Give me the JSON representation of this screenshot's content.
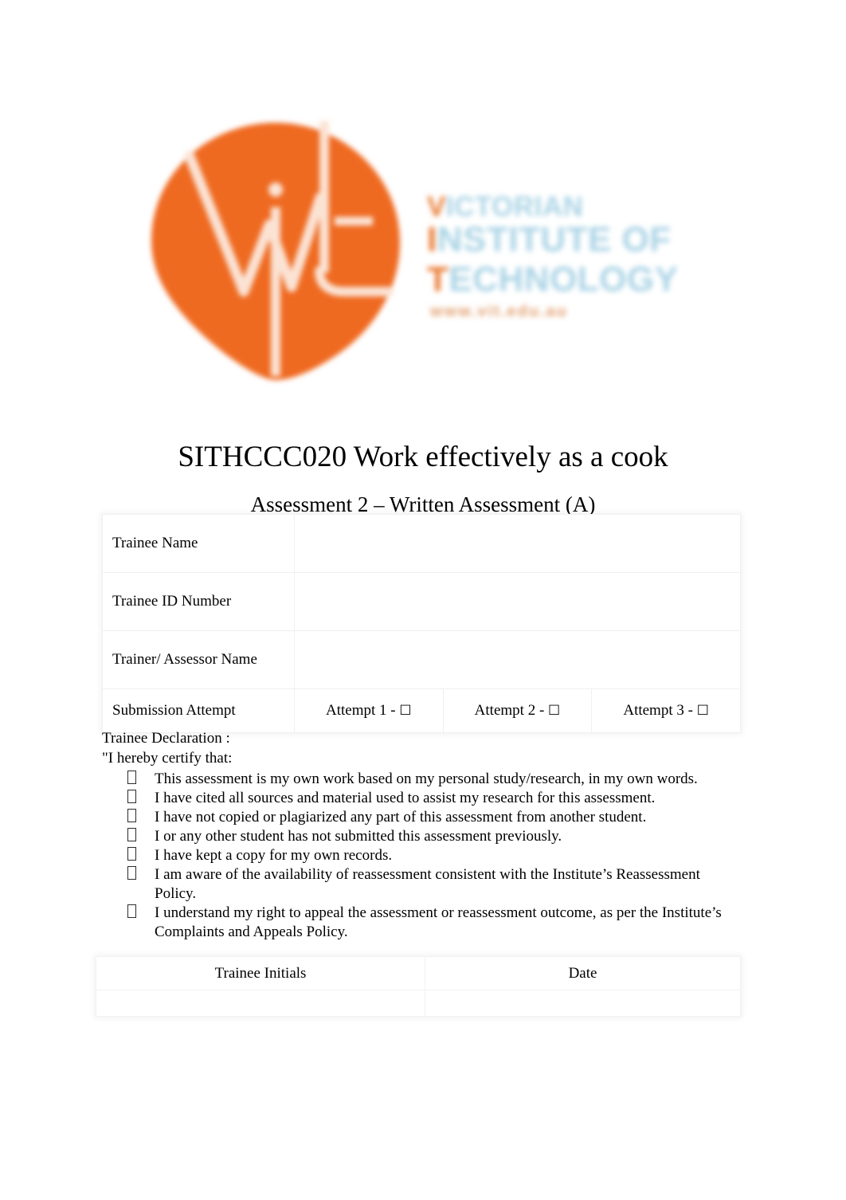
{
  "logo": {
    "mark_alt": "vit-logo-mark",
    "mark_letters": "vit",
    "orange_hex": "#EF6A21",
    "blue_hex": "#A9D3E5",
    "wordmark_lines": [
      {
        "lead": "V",
        "rest": "ICTORIAN"
      },
      {
        "lead": "I",
        "rest": "NSTITUTE OF"
      },
      {
        "lead": "T",
        "rest": "ECHNOLOGY"
      }
    ],
    "url": "www.vit.edu.au"
  },
  "header": {
    "title": "SITHCCC020 Work effectively as a cook",
    "subtitle": "Assessment 2 – Written Assessment (A)"
  },
  "details_table": {
    "rows": [
      {
        "label": "Trainee Name",
        "value": ""
      },
      {
        "label": "Trainee ID Number",
        "value": ""
      },
      {
        "label": "Trainer/ Assessor Name",
        "value": ""
      }
    ],
    "attempt_row": {
      "label": "Submission Attempt",
      "attempts": [
        {
          "label": "Attempt 1 -",
          "checkbox": "☐",
          "checked": false
        },
        {
          "label": "Attempt 2 -",
          "checkbox": "☐",
          "checked": false
        },
        {
          "label": "Attempt 3 -",
          "checkbox": "☐",
          "checked": false
        }
      ]
    }
  },
  "declaration": {
    "heading": "Trainee Declaration :",
    "intro": "\"I hereby certify that:",
    "items": [
      "This assessment is my own work based on my personal study/research, in my own words.",
      "I have cited all sources and material used to assist my research for this assessment.",
      "I have not copied or plagiarized any part of this assessment from another student.",
      "I or any other student has not submitted this assessment previously.",
      "I have kept a copy for my own records.",
      "I am aware of the availability of reassessment consistent with the Institute’s Reassessment Policy.",
      "I understand my right to appeal the assessment or reassessment outcome, as per the Institute’s Complaints and Appeals Policy."
    ]
  },
  "signoff_table": {
    "headers": [
      "Trainee Initials",
      "Date"
    ],
    "values": [
      "",
      ""
    ]
  }
}
